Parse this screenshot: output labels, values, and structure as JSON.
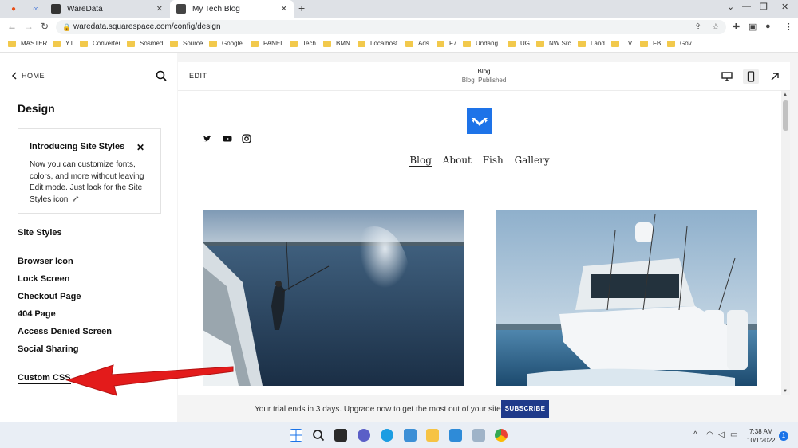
{
  "browser": {
    "tabs": [
      {
        "title": "WareData"
      },
      {
        "title": "My Tech Blog"
      }
    ],
    "url": "waredata.squarespace.com/config/design",
    "bookmarks": [
      "MASTER",
      "YT",
      "Converter",
      "Sosmed",
      "Source",
      "Google",
      "PANEL",
      "Tech",
      "BMN",
      "Localhost",
      "Ads",
      "F7",
      "Undang",
      "UG",
      "NW Src",
      "Land",
      "TV",
      "FB",
      "Gov"
    ]
  },
  "sidebar": {
    "home_label": "HOME",
    "title": "Design",
    "card": {
      "title": "Introducing Site Styles",
      "body": "Now you can customize fonts, colors, and more without leaving Edit mode. Just look for the Site Styles icon"
    },
    "items": [
      "Site Styles",
      "Browser Icon",
      "Lock Screen",
      "Checkout Page",
      "404 Page",
      "Access Denied Screen",
      "Social Sharing",
      "Custom CSS"
    ]
  },
  "preview": {
    "edit_label": "EDIT",
    "page_title": "Blog",
    "page_sub_left": "Blog",
    "page_sub_right": "Published",
    "nav": [
      "Blog",
      "About",
      "Fish",
      "Gallery"
    ]
  },
  "trial": {
    "text": "Your trial ends in 3 days. Upgrade now to get the most out of your site.",
    "button": "SUBSCRIBE"
  },
  "taskbar": {
    "time": "7:38 AM",
    "date": "10/1/2022",
    "notifications": "1"
  },
  "colors": {
    "accent": "#1e73e8",
    "subscribe_bg": "#1f3a8a",
    "arrow": "#e31b1b"
  }
}
